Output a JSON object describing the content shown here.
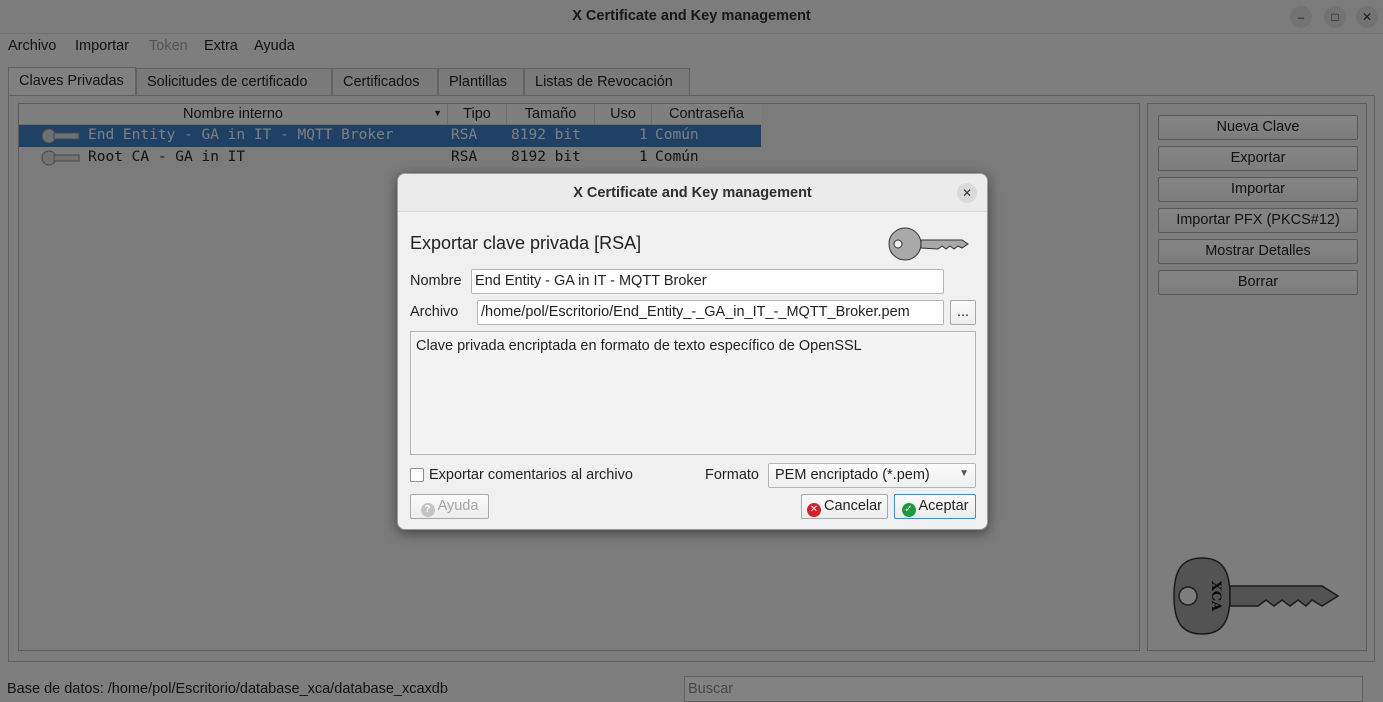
{
  "window": {
    "title": "X Certificate and Key management"
  },
  "menu": {
    "archivo": "Archivo",
    "importar": "Importar",
    "token": "Token",
    "extra": "Extra",
    "ayuda": "Ayuda"
  },
  "tabs": [
    "Claves Privadas",
    "Solicitudes de certificado",
    "Certificados",
    "Plantillas",
    "Listas de Revocación"
  ],
  "table": {
    "columns": [
      "Nombre interno",
      "Tipo",
      "Tamaño",
      "Uso",
      "Contraseña"
    ],
    "rows": [
      {
        "name": "End Entity - GA in IT - MQTT Broker",
        "type": "RSA",
        "size": "8192 bit",
        "use": "1",
        "password": "Común",
        "selected": true
      },
      {
        "name": "Root CA - GA in IT",
        "type": "RSA",
        "size": "8192 bit",
        "use": "1",
        "password": "Común",
        "selected": false
      }
    ]
  },
  "side_buttons": [
    "Nueva Clave",
    "Exportar",
    "Importar",
    "Importar PFX (PKCS#12)",
    "Mostrar Detalles",
    "Borrar"
  ],
  "status": {
    "database": "Base de datos: /home/pol/Escritorio/database_xca/database_xcaxdb",
    "search_placeholder": "Buscar"
  },
  "dialog": {
    "title": "X Certificate and Key management",
    "heading": "Exportar clave privada [RSA]",
    "name_label": "Nombre",
    "name_value": "End Entity - GA in IT - MQTT Broker",
    "file_label": "Archivo",
    "file_value": "/home/pol/Escritorio/End_Entity_-_GA_in_IT_-_MQTT_Broker.pem",
    "browse_label": "...",
    "description": "Clave privada encriptada en formato de texto específico de OpenSSL",
    "export_comments_label": "Exportar comentarios al archivo",
    "format_label": "Formato",
    "format_value": "PEM encriptado (*.pem)",
    "help_label": "Ayuda",
    "cancel_label": "Cancelar",
    "accept_label": "Aceptar"
  }
}
